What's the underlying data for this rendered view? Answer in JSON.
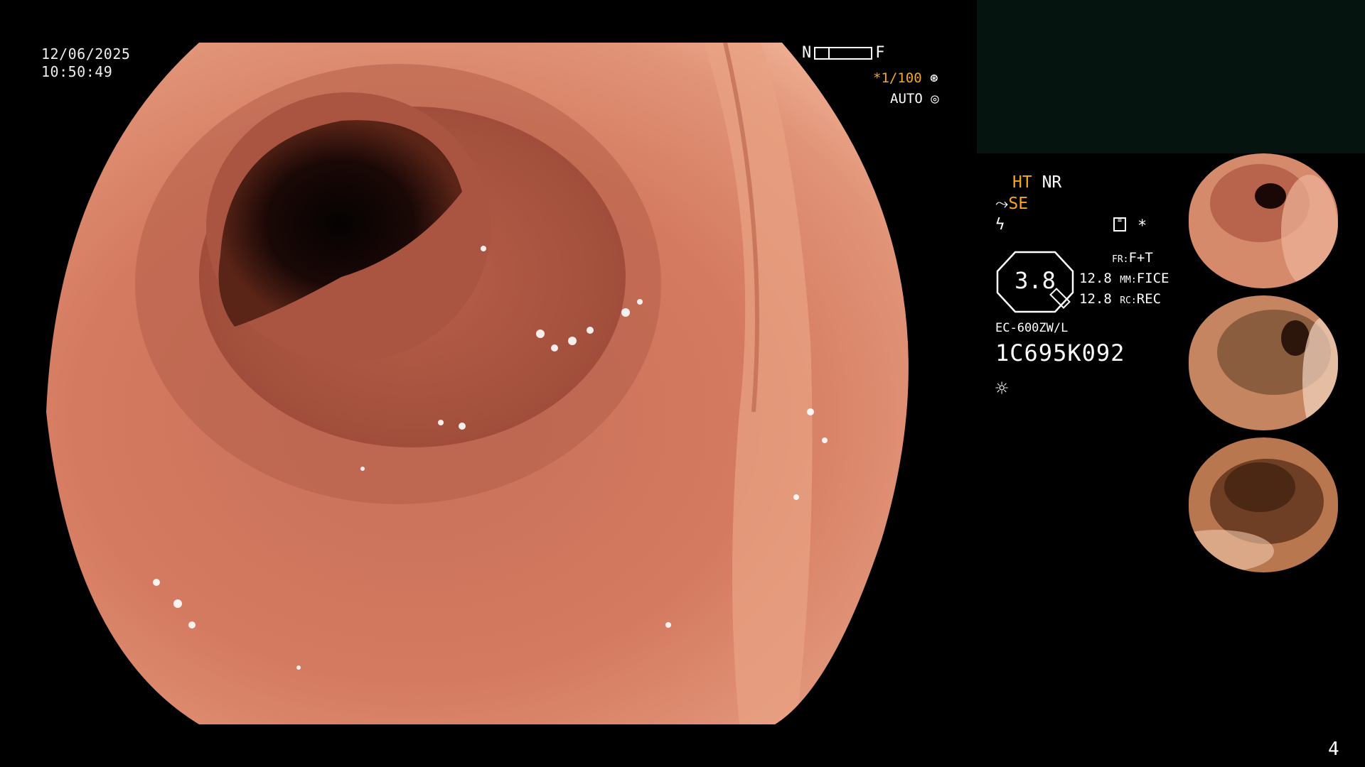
{
  "overlay": {
    "date": "12/06/2025",
    "time": "10:50:49",
    "near_label": "N",
    "far_label": "F",
    "shutter": "*1/100",
    "shutter_icon": "aperture-icon",
    "iris_mode": "AUTO",
    "iris_icon": "iris-icon"
  },
  "settings": {
    "ht": "HT",
    "nr": "NR",
    "se": "SE",
    "enhancement_level": "3.8",
    "fr_key": "FR:",
    "fr_val": "F+T",
    "mm_key": "MM:",
    "mm_val": "FICE",
    "rc_key": "RC:",
    "rc_val": "REC",
    "fr_num": "12.8",
    "mm_num": "12.8",
    "model": "EC-600ZW/L",
    "serial": "1C695K092"
  },
  "footer": {
    "page_number": "4"
  },
  "colors": {
    "accent_orange": "#f5a623",
    "panel_dark": "#061410"
  }
}
